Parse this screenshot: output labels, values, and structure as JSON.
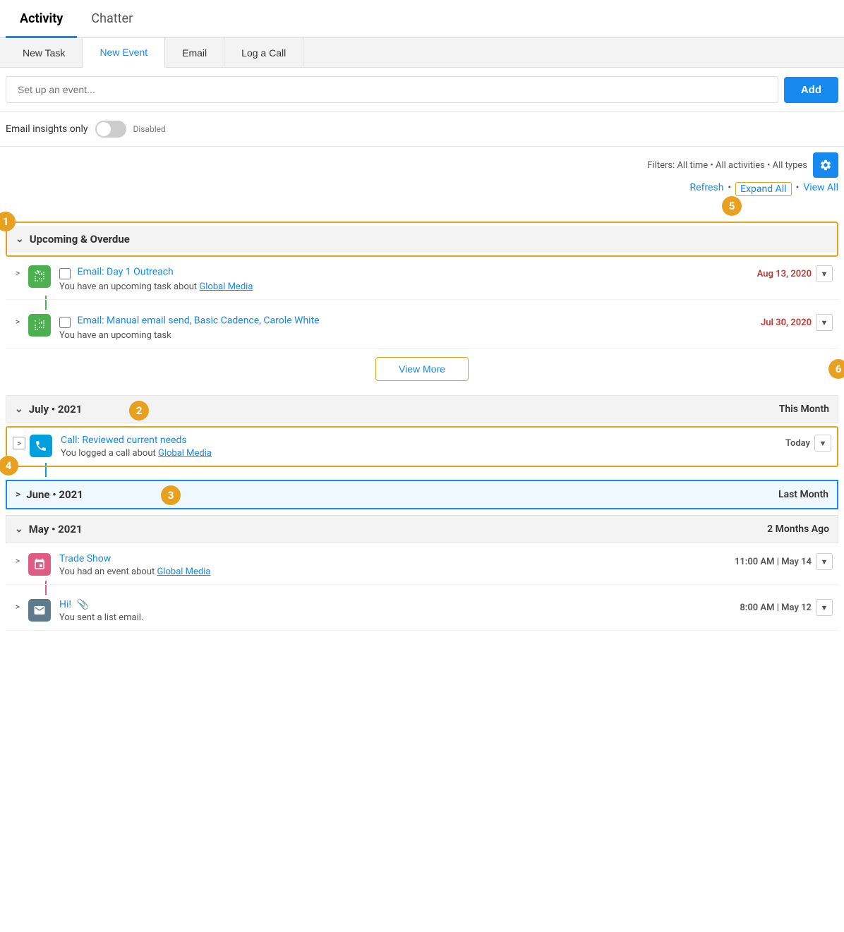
{
  "tabs": {
    "activity": "Activity",
    "chatter": "Chatter"
  },
  "action_tabs": [
    {
      "id": "new-task",
      "label": "New Task",
      "active": false
    },
    {
      "id": "new-event",
      "label": "New Event",
      "active": true
    },
    {
      "id": "email",
      "label": "Email",
      "active": false
    },
    {
      "id": "log-call",
      "label": "Log a Call",
      "active": false
    }
  ],
  "search_placeholder": "Set up an event...",
  "add_label": "Add",
  "toggle": {
    "label": "Email insights only",
    "status": "Disabled"
  },
  "filters": {
    "text": "Filters: All time • All activities • All types"
  },
  "actions": {
    "refresh": "Refresh",
    "expand_all": "Expand All",
    "view_all": "View All"
  },
  "upcoming_section": {
    "label": "Upcoming & Overdue",
    "items": [
      {
        "title": "Email: Day 1 Outreach",
        "description": "You have an upcoming task about",
        "link_text": "Global Media",
        "date": "Aug 13, 2020",
        "date_class": "overdue"
      },
      {
        "title": "Email: Manual email send, Basic Cadence, Carole White",
        "description": "You have an upcoming task",
        "link_text": "",
        "date": "Jul 30, 2020",
        "date_class": "overdue"
      }
    ],
    "view_more": "View More"
  },
  "month_sections": [
    {
      "id": "july-2021",
      "label": "July • 2021",
      "right": "This Month",
      "expanded": true,
      "items": [
        {
          "title": "Call: Reviewed current needs",
          "description": "You logged a call about",
          "link_text": "Global Media",
          "date": "Today",
          "icon_type": "call"
        }
      ]
    },
    {
      "id": "june-2021",
      "label": "June • 2021",
      "right": "Last Month",
      "expanded": false,
      "highlighted": true,
      "items": []
    },
    {
      "id": "may-2021",
      "label": "May • 2021",
      "right": "2 Months Ago",
      "expanded": true,
      "items": [
        {
          "title": "Trade Show",
          "description": "You had an event about",
          "link_text": "Global Media",
          "date": "11:00 AM | May 14",
          "icon_type": "event"
        },
        {
          "title": "Hi!",
          "description": "You sent a list email.",
          "link_text": "",
          "date": "8:00 AM | May 12",
          "icon_type": "email",
          "attachment": true
        }
      ]
    }
  ],
  "annotations": {
    "1": "1",
    "2": "2",
    "3": "3",
    "4": "4",
    "5": "5",
    "6": "6"
  }
}
